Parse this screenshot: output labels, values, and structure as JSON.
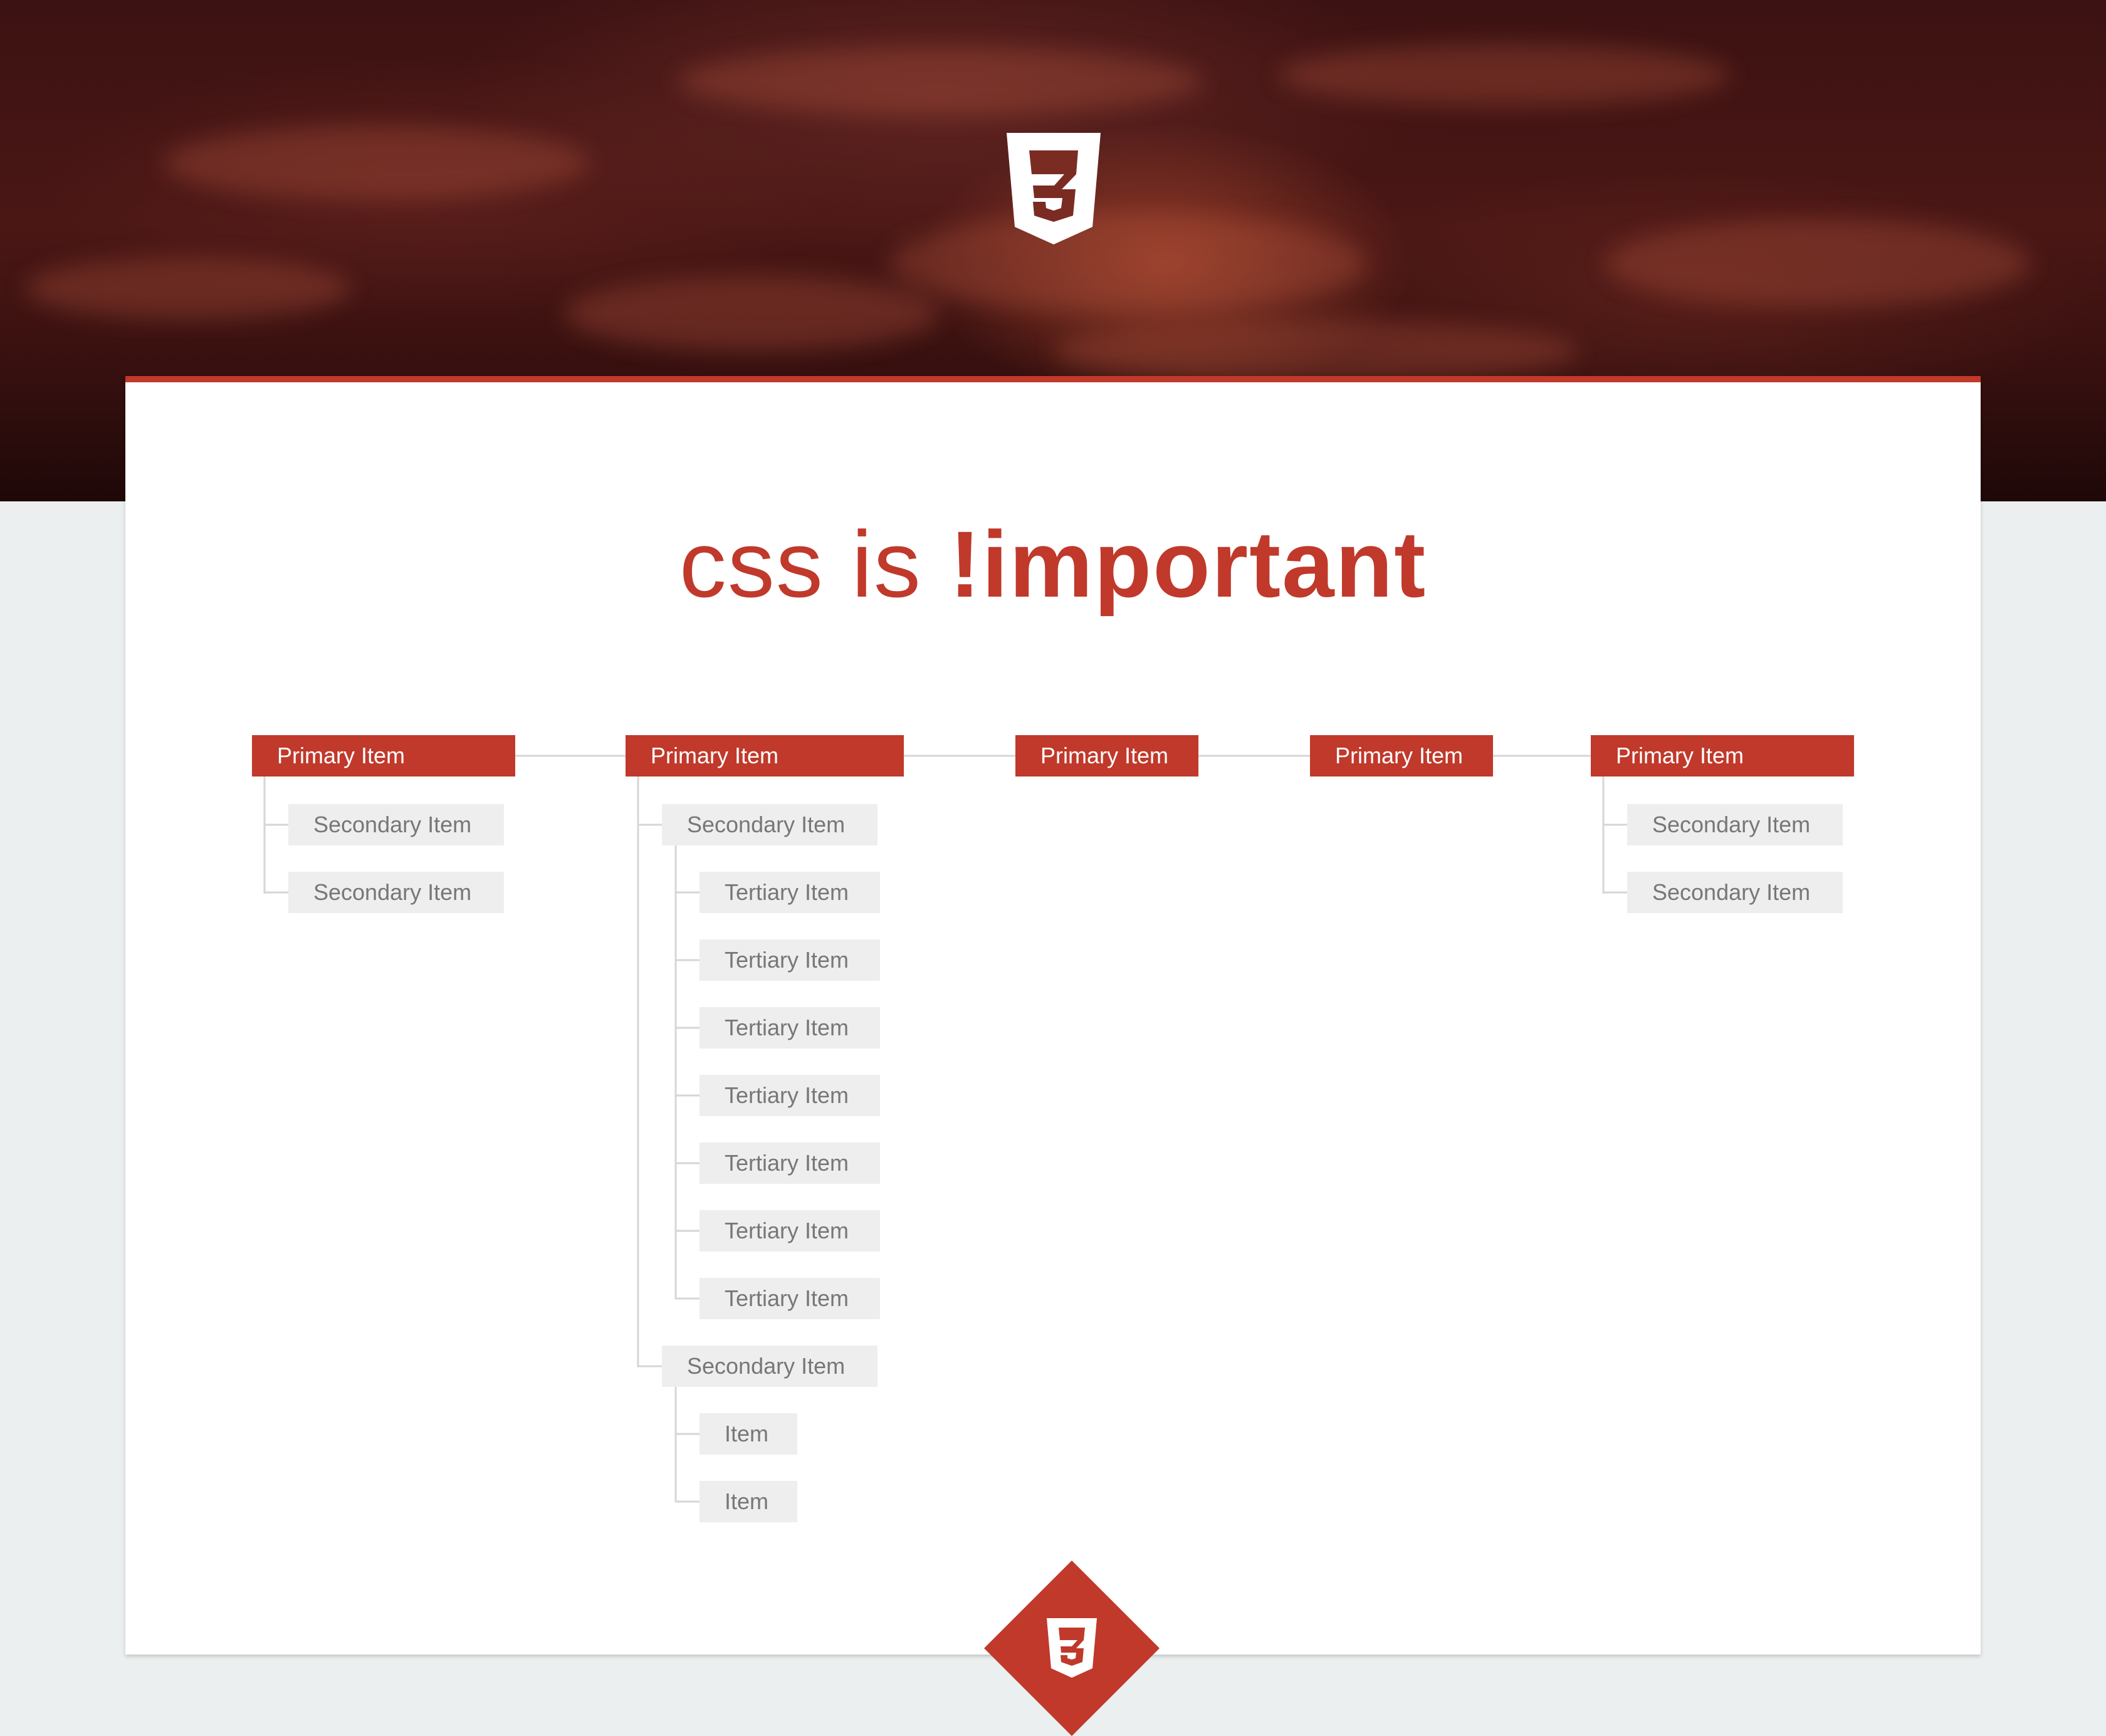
{
  "header": {
    "logo_icon": "css3-shield-icon"
  },
  "heading": {
    "prefix": "css is",
    "emphasis": "!important"
  },
  "sitemap": {
    "primary": [
      {
        "label": "Primary Item",
        "children": [
          "Secondary Item",
          "Secondary Item"
        ]
      },
      {
        "label": "Primary Item",
        "children": [
          {
            "label": "Secondary Item",
            "children": [
              "Tertiary Item",
              "Tertiary Item",
              "Tertiary Item",
              "Tertiary Item",
              "Tertiary Item",
              "Tertiary Item",
              "Tertiary Item"
            ]
          },
          {
            "label": "Secondary Item",
            "children": [
              "Item",
              "Item"
            ]
          }
        ]
      },
      {
        "label": "Primary Item",
        "children": []
      },
      {
        "label": "Primary Item",
        "children": []
      },
      {
        "label": "Primary Item",
        "children": [
          "Secondary Item",
          "Secondary Item"
        ]
      }
    ]
  },
  "footer": {
    "logo_icon": "css3-shield-icon"
  },
  "colors": {
    "accent": "#c0392b",
    "item_bg": "#eeeeee",
    "item_text": "#777777",
    "page_bg": "#ecefef"
  }
}
